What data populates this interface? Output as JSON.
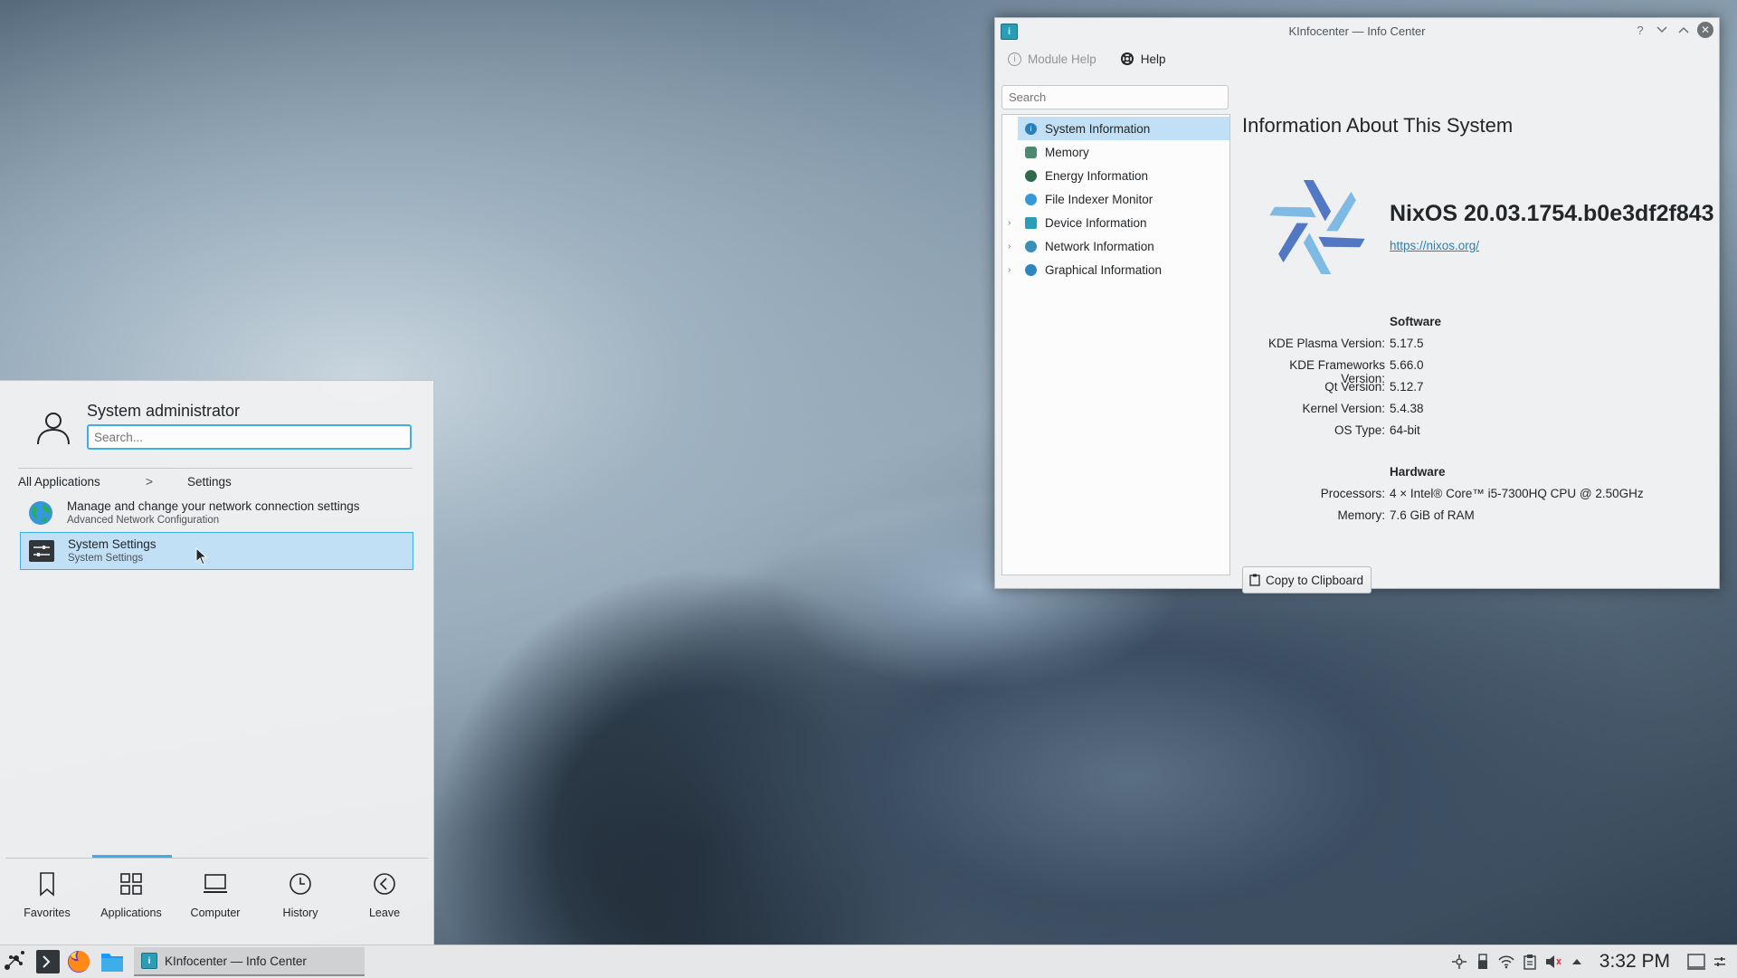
{
  "window": {
    "title": "KInfocenter — Info Center",
    "help_button": "?",
    "toolbar": {
      "module_help": "Module Help",
      "help": "Help"
    },
    "search_placeholder": "Search",
    "tree": [
      {
        "label": "System Information",
        "icon": "info-icon",
        "selected": true
      },
      {
        "label": "Memory",
        "icon": "memory-icon"
      },
      {
        "label": "Energy Information",
        "icon": "energy-icon"
      },
      {
        "label": "File Indexer Monitor",
        "icon": "file-indexer-icon"
      },
      {
        "label": "Device Information",
        "icon": "device-icon",
        "expandable": true
      },
      {
        "label": "Network Information",
        "icon": "network-icon",
        "expandable": true
      },
      {
        "label": "Graphical Information",
        "icon": "graphics-icon",
        "expandable": true
      }
    ],
    "content": {
      "heading": "Information About This System",
      "distro_name": "NixOS 20.03.1754.b0e3df2f843",
      "distro_url": "https://nixos.org/",
      "software_title": "Software",
      "software": [
        {
          "key": "KDE Plasma Version:",
          "value": "5.17.5"
        },
        {
          "key": "KDE Frameworks Version:",
          "value": "5.66.0"
        },
        {
          "key": "Qt Version:",
          "value": "5.12.7"
        },
        {
          "key": "Kernel Version:",
          "value": "5.4.38"
        },
        {
          "key": "OS Type:",
          "value": "64-bit"
        }
      ],
      "hardware_title": "Hardware",
      "hardware": [
        {
          "key": "Processors:",
          "value": "4 × Intel® Core™ i5-7300HQ CPU @ 2.50GHz"
        },
        {
          "key": "Memory:",
          "value": "7.6 GiB of RAM"
        }
      ],
      "copy_button": "Copy to Clipboard"
    }
  },
  "launcher": {
    "user_name": "System administrator",
    "search_placeholder": "Search...",
    "breadcrumb": {
      "root": "All Applications",
      "separator": ">",
      "current": "Settings"
    },
    "results": [
      {
        "title": "Manage and change your network connection settings",
        "subtitle": "Advanced Network Configuration"
      },
      {
        "title": "System Settings",
        "subtitle": "System Settings"
      }
    ],
    "tabs": [
      {
        "label": "Favorites"
      },
      {
        "label": "Applications"
      },
      {
        "label": "Computer"
      },
      {
        "label": "History"
      },
      {
        "label": "Leave"
      }
    ]
  },
  "taskbar": {
    "task_title": "KInfocenter — Info Center",
    "clock": "3:32 PM"
  },
  "colors": {
    "accent": "#3daee9",
    "selection": "#c2e0f5",
    "link": "#2980b9",
    "nix_dark": "#5277c3",
    "nix_light": "#7ebae4"
  }
}
